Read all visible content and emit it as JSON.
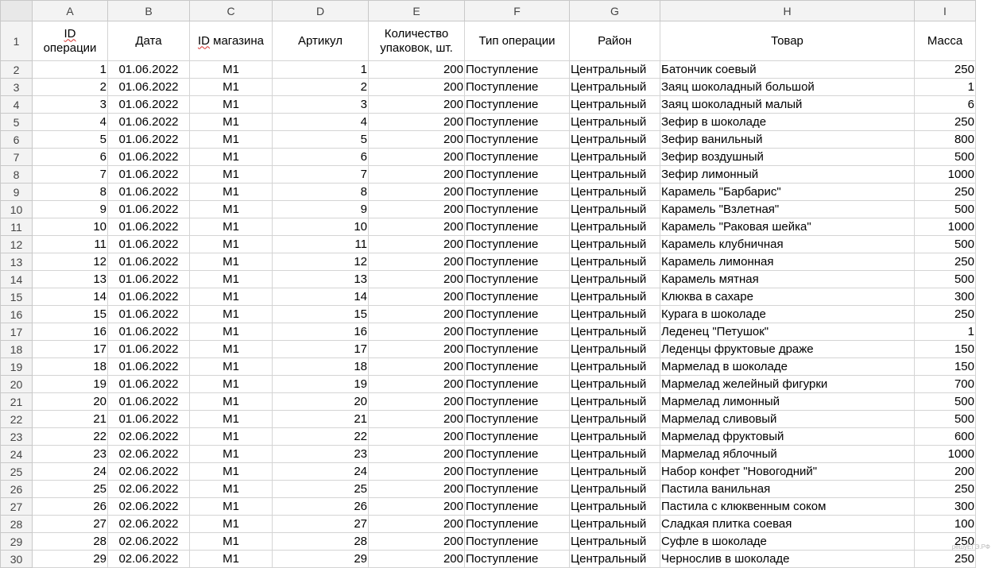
{
  "columns": [
    "A",
    "B",
    "C",
    "D",
    "E",
    "F",
    "G",
    "H",
    "I"
  ],
  "headers": {
    "a1": "ID",
    "a2": "операции",
    "b": "Дата",
    "c1": "ID",
    "c2": " магазина",
    "d": "Артикул",
    "e1": "Количество",
    "e2": "упаковок, шт.",
    "f": "Тип операции",
    "g": "Район",
    "h": "Товар",
    "i": "Масса"
  },
  "header_row_number": "1",
  "rows": [
    {
      "n": "2",
      "id": "1",
      "date": "01.06.2022",
      "shop": "М1",
      "art": "1",
      "qty": "200",
      "op": "Поступление",
      "district": "Центральный",
      "product": "Батончик соевый",
      "mass": "250"
    },
    {
      "n": "3",
      "id": "2",
      "date": "01.06.2022",
      "shop": "М1",
      "art": "2",
      "qty": "200",
      "op": "Поступление",
      "district": "Центральный",
      "product": "Заяц шоколадный большой",
      "mass": "1"
    },
    {
      "n": "4",
      "id": "3",
      "date": "01.06.2022",
      "shop": "М1",
      "art": "3",
      "qty": "200",
      "op": "Поступление",
      "district": "Центральный",
      "product": "Заяц шоколадный малый",
      "mass": "6"
    },
    {
      "n": "5",
      "id": "4",
      "date": "01.06.2022",
      "shop": "М1",
      "art": "4",
      "qty": "200",
      "op": "Поступление",
      "district": "Центральный",
      "product": "Зефир в шоколаде",
      "mass": "250"
    },
    {
      "n": "6",
      "id": "5",
      "date": "01.06.2022",
      "shop": "М1",
      "art": "5",
      "qty": "200",
      "op": "Поступление",
      "district": "Центральный",
      "product": "Зефир ванильный",
      "mass": "800"
    },
    {
      "n": "7",
      "id": "6",
      "date": "01.06.2022",
      "shop": "М1",
      "art": "6",
      "qty": "200",
      "op": "Поступление",
      "district": "Центральный",
      "product": "Зефир воздушный",
      "mass": "500"
    },
    {
      "n": "8",
      "id": "7",
      "date": "01.06.2022",
      "shop": "М1",
      "art": "7",
      "qty": "200",
      "op": "Поступление",
      "district": "Центральный",
      "product": "Зефир лимонный",
      "mass": "1000"
    },
    {
      "n": "9",
      "id": "8",
      "date": "01.06.2022",
      "shop": "М1",
      "art": "8",
      "qty": "200",
      "op": "Поступление",
      "district": "Центральный",
      "product": "Карамель \"Барбарис\"",
      "mass": "250"
    },
    {
      "n": "10",
      "id": "9",
      "date": "01.06.2022",
      "shop": "М1",
      "art": "9",
      "qty": "200",
      "op": "Поступление",
      "district": "Центральный",
      "product": "Карамель \"Взлетная\"",
      "mass": "500"
    },
    {
      "n": "11",
      "id": "10",
      "date": "01.06.2022",
      "shop": "М1",
      "art": "10",
      "qty": "200",
      "op": "Поступление",
      "district": "Центральный",
      "product": "Карамель \"Раковая шейка\"",
      "mass": "1000"
    },
    {
      "n": "12",
      "id": "11",
      "date": "01.06.2022",
      "shop": "М1",
      "art": "11",
      "qty": "200",
      "op": "Поступление",
      "district": "Центральный",
      "product": "Карамель клубничная",
      "mass": "500"
    },
    {
      "n": "13",
      "id": "12",
      "date": "01.06.2022",
      "shop": "М1",
      "art": "12",
      "qty": "200",
      "op": "Поступление",
      "district": "Центральный",
      "product": "Карамель лимонная",
      "mass": "250"
    },
    {
      "n": "14",
      "id": "13",
      "date": "01.06.2022",
      "shop": "М1",
      "art": "13",
      "qty": "200",
      "op": "Поступление",
      "district": "Центральный",
      "product": "Карамель мятная",
      "mass": "500"
    },
    {
      "n": "15",
      "id": "14",
      "date": "01.06.2022",
      "shop": "М1",
      "art": "14",
      "qty": "200",
      "op": "Поступление",
      "district": "Центральный",
      "product": "Клюква в сахаре",
      "mass": "300"
    },
    {
      "n": "16",
      "id": "15",
      "date": "01.06.2022",
      "shop": "М1",
      "art": "15",
      "qty": "200",
      "op": "Поступление",
      "district": "Центральный",
      "product": "Курага в шоколаде",
      "mass": "250"
    },
    {
      "n": "17",
      "id": "16",
      "date": "01.06.2022",
      "shop": "М1",
      "art": "16",
      "qty": "200",
      "op": "Поступление",
      "district": "Центральный",
      "product": "Леденец \"Петушок\"",
      "mass": "1"
    },
    {
      "n": "18",
      "id": "17",
      "date": "01.06.2022",
      "shop": "М1",
      "art": "17",
      "qty": "200",
      "op": "Поступление",
      "district": "Центральный",
      "product": "Леденцы фруктовые драже",
      "mass": "150"
    },
    {
      "n": "19",
      "id": "18",
      "date": "01.06.2022",
      "shop": "М1",
      "art": "18",
      "qty": "200",
      "op": "Поступление",
      "district": "Центральный",
      "product": "Мармелад в шоколаде",
      "mass": "150"
    },
    {
      "n": "20",
      "id": "19",
      "date": "01.06.2022",
      "shop": "М1",
      "art": "19",
      "qty": "200",
      "op": "Поступление",
      "district": "Центральный",
      "product": "Мармелад желейный фигурки",
      "mass": "700"
    },
    {
      "n": "21",
      "id": "20",
      "date": "01.06.2022",
      "shop": "М1",
      "art": "20",
      "qty": "200",
      "op": "Поступление",
      "district": "Центральный",
      "product": "Мармелад лимонный",
      "mass": "500"
    },
    {
      "n": "22",
      "id": "21",
      "date": "01.06.2022",
      "shop": "М1",
      "art": "21",
      "qty": "200",
      "op": "Поступление",
      "district": "Центральный",
      "product": "Мармелад сливовый",
      "mass": "500"
    },
    {
      "n": "23",
      "id": "22",
      "date": "02.06.2022",
      "shop": "М1",
      "art": "22",
      "qty": "200",
      "op": "Поступление",
      "district": "Центральный",
      "product": "Мармелад фруктовый",
      "mass": "600"
    },
    {
      "n": "24",
      "id": "23",
      "date": "02.06.2022",
      "shop": "М1",
      "art": "23",
      "qty": "200",
      "op": "Поступление",
      "district": "Центральный",
      "product": "Мармелад яблочный",
      "mass": "1000"
    },
    {
      "n": "25",
      "id": "24",
      "date": "02.06.2022",
      "shop": "М1",
      "art": "24",
      "qty": "200",
      "op": "Поступление",
      "district": "Центральный",
      "product": "Набор конфет \"Новогодний\"",
      "mass": "200"
    },
    {
      "n": "26",
      "id": "25",
      "date": "02.06.2022",
      "shop": "М1",
      "art": "25",
      "qty": "200",
      "op": "Поступление",
      "district": "Центральный",
      "product": "Пастила ванильная",
      "mass": "250"
    },
    {
      "n": "27",
      "id": "26",
      "date": "02.06.2022",
      "shop": "М1",
      "art": "26",
      "qty": "200",
      "op": "Поступление",
      "district": "Центральный",
      "product": "Пастила с клюквенным соком",
      "mass": "300"
    },
    {
      "n": "28",
      "id": "27",
      "date": "02.06.2022",
      "shop": "М1",
      "art": "27",
      "qty": "200",
      "op": "Поступление",
      "district": "Центральный",
      "product": "Сладкая плитка соевая",
      "mass": "100"
    },
    {
      "n": "29",
      "id": "28",
      "date": "02.06.2022",
      "shop": "М1",
      "art": "28",
      "qty": "200",
      "op": "Поступление",
      "district": "Центральный",
      "product": "Суфле в шоколаде",
      "mass": "250"
    },
    {
      "n": "30",
      "id": "29",
      "date": "02.06.2022",
      "shop": "М1",
      "art": "29",
      "qty": "200",
      "op": "Поступление",
      "district": "Центральный",
      "product": "Чернослив в шоколаде",
      "mass": "250"
    }
  ],
  "watermark": "решуЕГЭ.РФ"
}
